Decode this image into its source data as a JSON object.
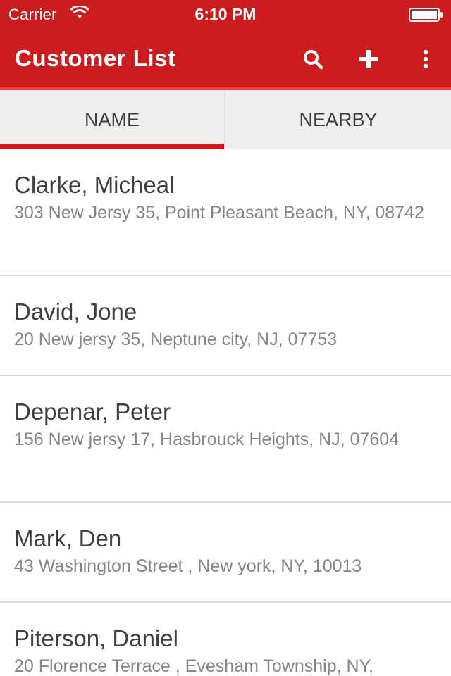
{
  "status_bar": {
    "carrier": "Carrier",
    "time": "6:10 PM",
    "wifi_icon": "wifi-icon",
    "battery_icon": "battery-icon",
    "battery_level": 1.0
  },
  "app_bar": {
    "title": "Customer List",
    "background_color": "#cb1d20",
    "actions": [
      {
        "icon": "search-icon"
      },
      {
        "icon": "plus-icon"
      },
      {
        "icon": "more-vertical-icon"
      }
    ]
  },
  "tabs": [
    {
      "label": "NAME",
      "selected": true
    },
    {
      "label": "NEARBY",
      "selected": false
    }
  ],
  "customers": [
    {
      "name": "Clarke, Micheal",
      "address": "303 New Jersy 35, Point Pleasant Beach, NY, 08742"
    },
    {
      "name": "David, Jone",
      "address": "20 New jersy 35, Neptune city, NJ, 07753"
    },
    {
      "name": "Depenar, Peter",
      "address": "156 New jersy 17, Hasbrouck Heights, NJ, 07604"
    },
    {
      "name": "Mark, Den",
      "address": "43 Washington Street , New york, NY, 10013"
    },
    {
      "name": "Piterson, Daniel",
      "address": "20 Florence Terrace , Evesham Township, NY,"
    }
  ]
}
